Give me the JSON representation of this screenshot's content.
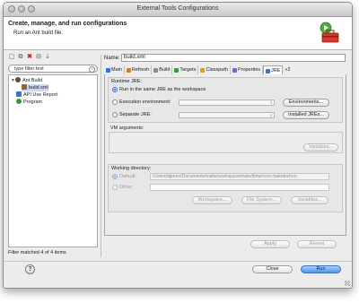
{
  "window": {
    "title": "External Tools Configurations"
  },
  "banner": {
    "title": "Create, manage, and run configurations",
    "subtitle": "Run an Ant build file."
  },
  "left": {
    "filter_placeholder": "type filter text",
    "tree": [
      {
        "label": "Ant Build",
        "level": 0,
        "expanded": true
      },
      {
        "label": "build.xml",
        "level": 1,
        "selected": true
      },
      {
        "label": "API Use Report",
        "level": 0
      },
      {
        "label": "Program",
        "level": 0
      }
    ],
    "status": "Filter matched 4 of 4 items"
  },
  "right": {
    "name_label": "Name:",
    "name_value": "build.xml",
    "tabs": [
      {
        "label": "Main",
        "color": "#3b6fd1"
      },
      {
        "label": "Refresh",
        "color": "#e07b1a"
      },
      {
        "label": "Build",
        "color": "#8a8a8a"
      },
      {
        "label": "Targets",
        "color": "#3a9a3a"
      },
      {
        "label": "Classpath",
        "color": "#d4a017"
      },
      {
        "label": "Properties",
        "color": "#6a6ad0"
      },
      {
        "label": "JRE",
        "color": "#3b6fd1",
        "active": true
      },
      {
        "label": "»2",
        "color": ""
      }
    ],
    "runtime_jre": {
      "group_label": "Runtime JRE:",
      "option_same": "Run in the same JRE as the workspace",
      "option_exec_env": "Execution environment:",
      "option_separate": "Separate JRE:",
      "environments_button": "Environments...",
      "installed_jres_button": "Installed JREs..."
    },
    "vm_arguments": {
      "group_label": "VM arguments:",
      "variables_button": "Variables..."
    },
    "working_directory": {
      "group_label": "Working directory:",
      "default_label": "Default:",
      "default_value": "/Users/dgreen/Documents/make/workspace/main/dmw/com.maketechno",
      "other_label": "Other:",
      "workspace_button": "Workspace...",
      "filesystem_button": "File System...",
      "variables_button": "Variables..."
    },
    "apply_button": "Apply",
    "revert_button": "Revert"
  },
  "footer": {
    "help_label": "?",
    "close_button": "Close",
    "run_button": "Run"
  },
  "colors": {
    "run_button": "#4f95e8",
    "selection": "#c8d9f0"
  }
}
